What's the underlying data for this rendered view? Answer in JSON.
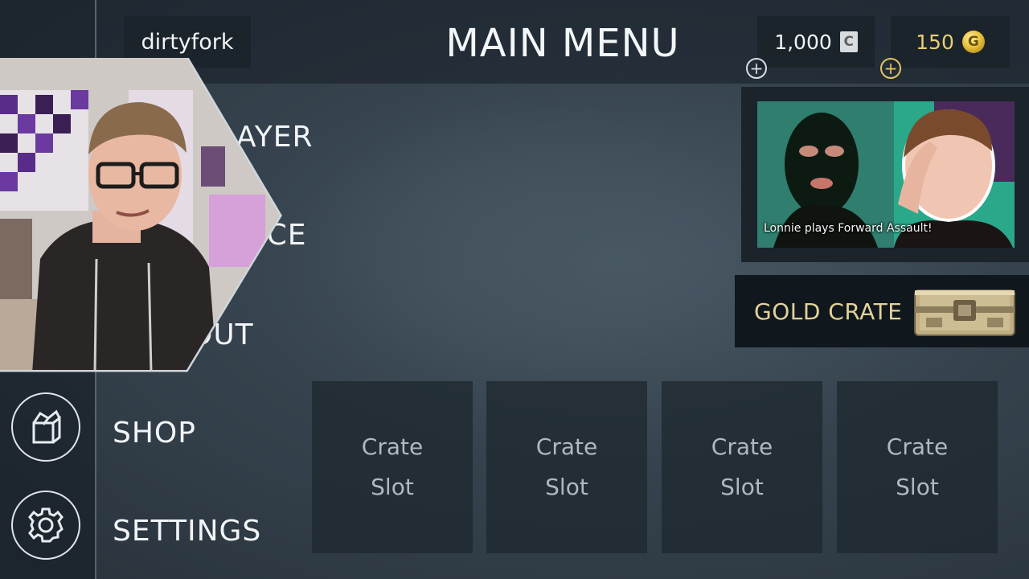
{
  "header": {
    "username": "dirtyfork",
    "title": "MAIN MENU"
  },
  "currency": {
    "credits": "1,000",
    "credits_icon_glyph": "C",
    "gold": "150",
    "gold_icon_glyph": "G",
    "add_glyph": "+"
  },
  "menu": {
    "item_1_visible": "LAYER",
    "item_2_visible": "ICE",
    "item_3_visible": "OUT",
    "shop": "SHOP",
    "settings": "SETTINGS"
  },
  "news": {
    "caption": "Lonnie plays Forward Assault!"
  },
  "gold_crate": {
    "label": "GOLD CRATE"
  },
  "crate_slots": [
    {
      "line1": "Crate",
      "line2": "Slot"
    },
    {
      "line1": "Crate",
      "line2": "Slot"
    },
    {
      "line1": "Crate",
      "line2": "Slot"
    },
    {
      "line1": "Crate",
      "line2": "Slot"
    }
  ],
  "icons": {
    "shop": "crate-icon",
    "settings": "gear-icon",
    "add": "plus-circle-icon"
  },
  "colors": {
    "gold_text": "#e7cf74",
    "panel": "#1b232b",
    "background": "#36434e"
  }
}
